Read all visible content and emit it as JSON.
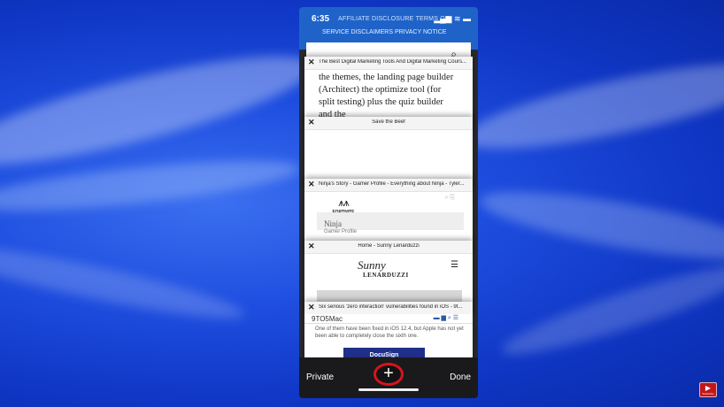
{
  "status_bar": {
    "time": "6:35",
    "links_row1": "AFFILIATE DISCLOSURE     TERMS OF",
    "links_row2": "SERVICE   DISCLAIMERS   PRIVACY NOTICE",
    "icons": "▂▄▆ ≋ ▬"
  },
  "peek_search_icon": "search-icon",
  "tabs": [
    {
      "title": "The Best Digital Marketing Tools And Digital Marketing Cours...",
      "body": "the themes, the landing page builder (Architect) the optimize tool (for split testing) plus the quiz builder and the"
    },
    {
      "title": "Save the Beef"
    },
    {
      "title": "Ninja's Story - Gamer Profile - Everything about Ninja - Tyler...",
      "logo": "FORTNITE",
      "heading": "Ninja",
      "subheading": "Gamer Profile"
    },
    {
      "title": "Home - Sunny Lenarduzzi",
      "logo_line1": "Sunny",
      "logo_line2": "LENARDUZZI"
    },
    {
      "title": "Six serious 'zero interaction' vulnerabilities found in iOS - 9t...",
      "brand": "9TO5Mac",
      "text": "One of them have been fixed in iOS 12.4, but Apple has not yet been able to completely close the sixth one.",
      "banner": "DocuSign"
    }
  ],
  "toolbar": {
    "private_label": "Private",
    "done_label": "Done",
    "add_label": "+"
  },
  "watermark": {
    "label": "▶",
    "sub": "Subscribe"
  }
}
